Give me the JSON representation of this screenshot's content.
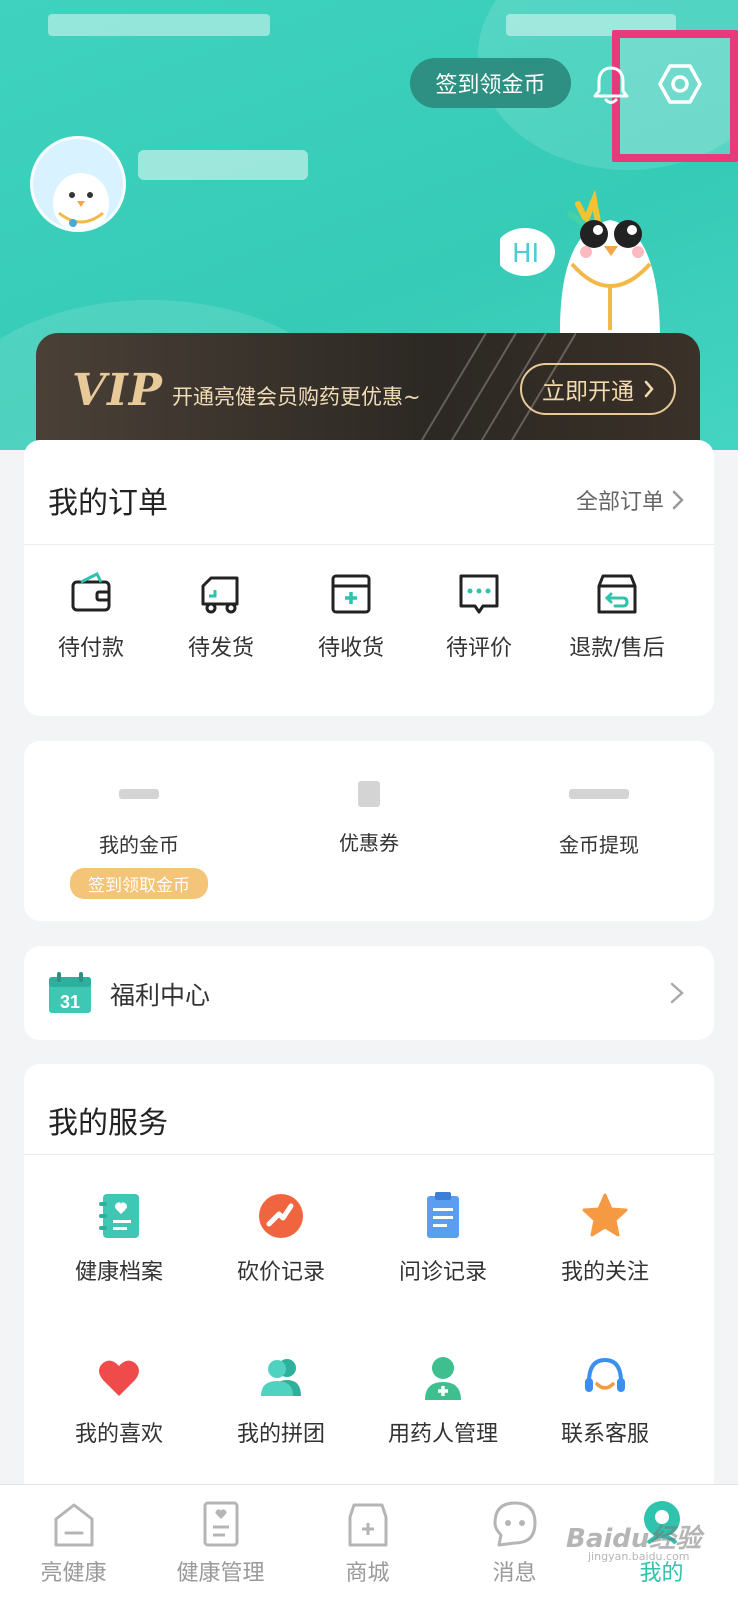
{
  "header": {
    "checkin_label": "签到领金币",
    "accent": "#36cbb6",
    "highlight_color": "#e8397a"
  },
  "vip": {
    "logo": "VIP",
    "promo": "开通亮健会员购药更优惠~",
    "cta": "立即开通"
  },
  "orders": {
    "title": "我的订单",
    "all_link": "全部订单",
    "items": [
      {
        "label": "待付款",
        "icon": "wallet-icon"
      },
      {
        "label": "待发货",
        "icon": "truck-icon"
      },
      {
        "label": "待收货",
        "icon": "package-icon"
      },
      {
        "label": "待评价",
        "icon": "comment-icon"
      },
      {
        "label": "退款/售后",
        "icon": "refund-box-icon"
      }
    ]
  },
  "assets": {
    "items": [
      {
        "label": "我的金币"
      },
      {
        "label": "优惠券"
      },
      {
        "label": "金币提现"
      }
    ],
    "coin_badge": "签到领取金币"
  },
  "welfare": {
    "label": "福利中心",
    "calendar_day": "31"
  },
  "services": {
    "title": "我的服务",
    "items": [
      {
        "label": "健康档案",
        "icon": "health-record-icon"
      },
      {
        "label": "砍价记录",
        "icon": "bargain-icon"
      },
      {
        "label": "问诊记录",
        "icon": "consult-record-icon"
      },
      {
        "label": "我的关注",
        "icon": "star-icon"
      },
      {
        "label": "我的喜欢",
        "icon": "heart-icon"
      },
      {
        "label": "我的拼团",
        "icon": "group-buy-icon"
      },
      {
        "label": "用药人管理",
        "icon": "patient-icon"
      },
      {
        "label": "联系客服",
        "icon": "headset-icon"
      }
    ]
  },
  "tabbar": {
    "items": [
      {
        "label": "亮健康"
      },
      {
        "label": "健康管理"
      },
      {
        "label": "商城"
      },
      {
        "label": "消息"
      },
      {
        "label": "我的"
      }
    ],
    "active_index": 4
  },
  "watermark": {
    "brand": "Baidu经验",
    "url": "jingyan.baidu.com"
  }
}
